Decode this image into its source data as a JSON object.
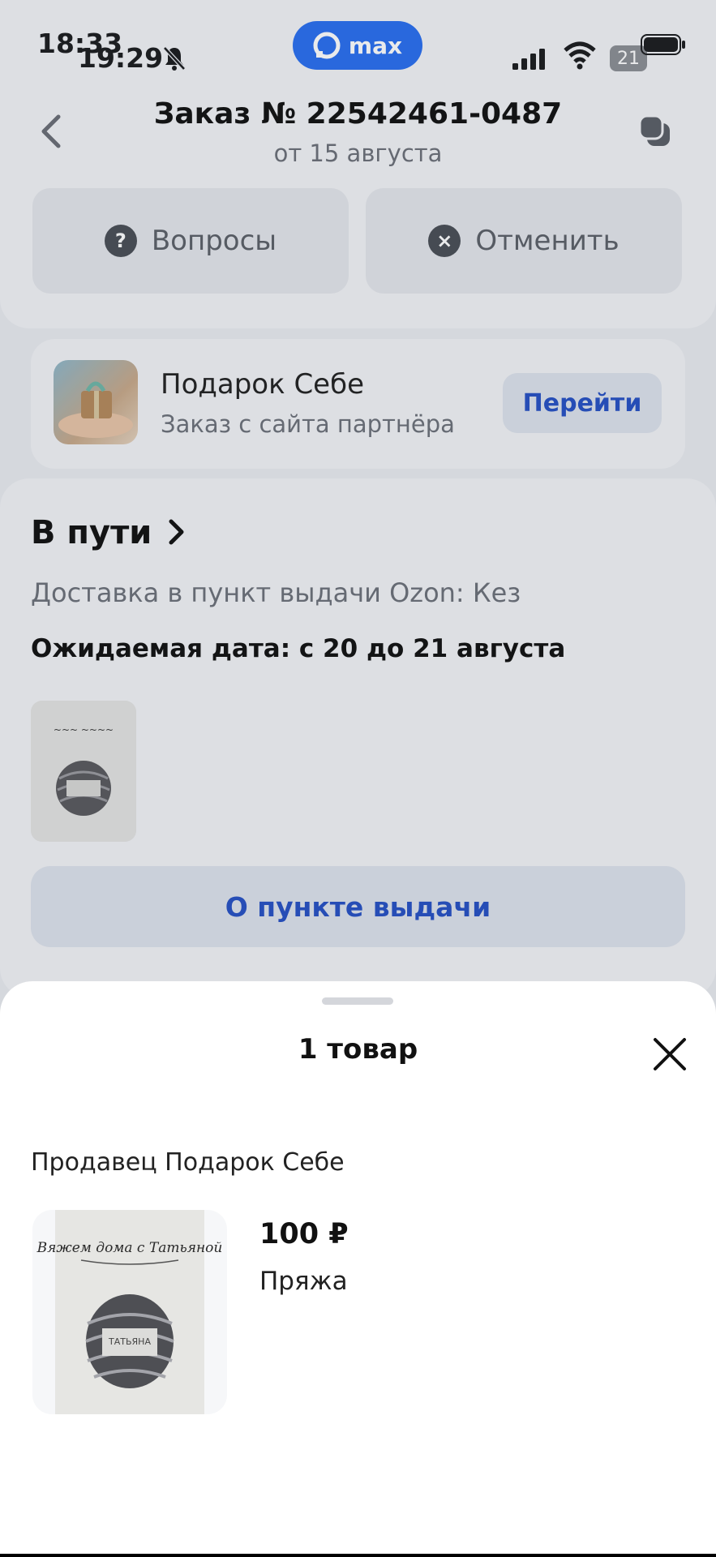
{
  "status_bar": {
    "time_primary": "18:33",
    "time_secondary": "19:29",
    "app_pill": "max",
    "badge": "21"
  },
  "header": {
    "title": "Заказ № 22542461-0487",
    "subtitle": "от 15 августа",
    "questions_label": "Вопросы",
    "cancel_label": "Отменить"
  },
  "partner": {
    "name": "Подарок Себе",
    "subtitle": "Заказ с сайта партнёра",
    "go_label": "Перейти"
  },
  "delivery": {
    "status": "В пути",
    "method": "Доставка в пункт выдачи Ozon: Кез",
    "expected": "Ожидаемая дата: с 20 до 21 августа",
    "pickup_button": "О пункте выдачи"
  },
  "sheet": {
    "title": "1 товар",
    "seller": "Продавец Подарок Себе",
    "product": {
      "price": "100 ₽",
      "name": "Пряжа",
      "image_caption": "Вяжем дома с Татьяной",
      "label_text": "ТАТЬЯНА"
    }
  },
  "colors": {
    "accent": "#2651c4",
    "pill": "#2a6ff0",
    "background": "#e9ebf0"
  }
}
